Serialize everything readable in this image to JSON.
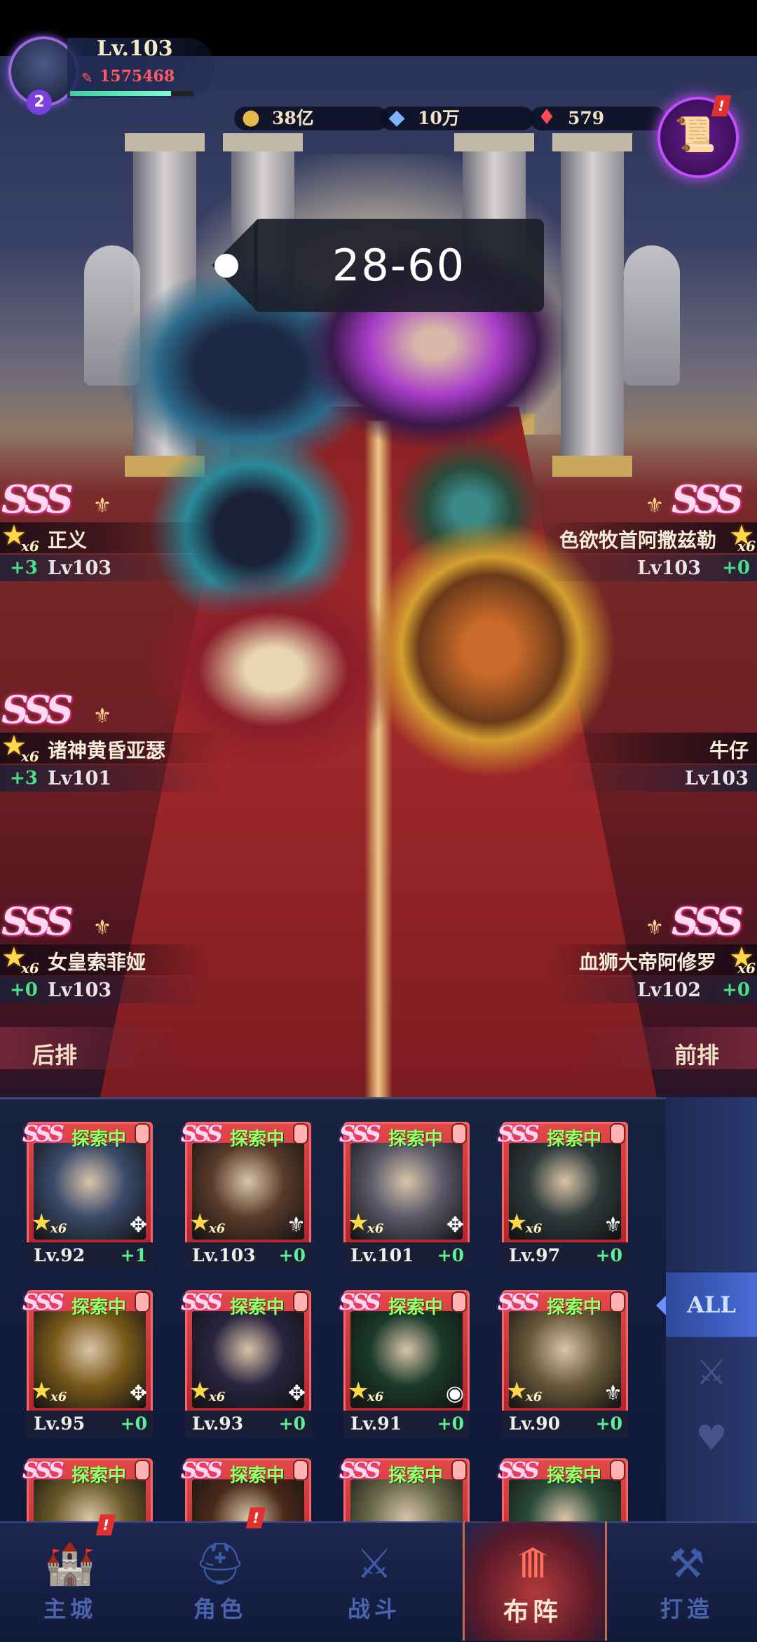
{
  "player": {
    "level": "Lv.103",
    "power": "1575468",
    "vip": "2"
  },
  "currencies": [
    {
      "icon": "gold-coin-icon",
      "value": "38亿"
    },
    {
      "icon": "diamond-icon",
      "value": "10万"
    },
    {
      "icon": "ruby-icon",
      "value": "579"
    }
  ],
  "stage": {
    "label": "28-60"
  },
  "formation": {
    "back_label": "后排",
    "front_label": "前排",
    "heroes": [
      {
        "name": "正义",
        "plus": "+3",
        "level": "Lv103",
        "grade": "SSS",
        "stars": "x6"
      },
      {
        "name": "色欲牧首阿撒兹勒",
        "plus": "+0",
        "level": "Lv103",
        "grade": "SSS",
        "stars": "x6"
      },
      {
        "name": "诸神黄昏亚瑟",
        "plus": "+3",
        "level": "Lv101",
        "grade": "SSS",
        "stars": "x6"
      },
      {
        "name": "牛仔",
        "plus": "",
        "level": "Lv103",
        "grade": "",
        "stars": ""
      },
      {
        "name": "女皇索菲娅",
        "plus": "+0",
        "level": "Lv103",
        "grade": "SSS",
        "stars": "x6"
      },
      {
        "name": "血狮大帝阿修罗",
        "plus": "+0",
        "level": "Lv102",
        "grade": "SSS",
        "stars": "x6"
      }
    ]
  },
  "roster": {
    "status": "探索中",
    "grade": "SSS",
    "stars": "x6",
    "cards": [
      {
        "level": "Lv.92",
        "plus": "+1",
        "color": "#3a4a6a",
        "emblem": "sword"
      },
      {
        "level": "Lv.103",
        "plus": "+0",
        "color": "#5a3b2a",
        "emblem": "shield"
      },
      {
        "level": "Lv.101",
        "plus": "+0",
        "color": "#5a5a6a",
        "emblem": "sword"
      },
      {
        "level": "Lv.97",
        "plus": "+0",
        "color": "#2e3a3a",
        "emblem": "shield"
      },
      {
        "level": "Lv.95",
        "plus": "+0",
        "color": "#7a5a1a",
        "emblem": "sword"
      },
      {
        "level": "Lv.93",
        "plus": "+0",
        "color": "#2a2440",
        "emblem": "sword"
      },
      {
        "level": "Lv.91",
        "plus": "+0",
        "color": "#1a3a2a",
        "emblem": "orb"
      },
      {
        "level": "Lv.90",
        "plus": "+0",
        "color": "#6a5a3a",
        "emblem": "shield"
      },
      {
        "level": "",
        "plus": "",
        "color": "#6a5a2a",
        "emblem": ""
      },
      {
        "level": "",
        "plus": "",
        "color": "#4a2a1a",
        "emblem": ""
      },
      {
        "level": "",
        "plus": "",
        "color": "#6a6a4a",
        "emblem": ""
      },
      {
        "level": "",
        "plus": "",
        "color": "#2a4a3a",
        "emblem": ""
      }
    ]
  },
  "filters": {
    "all": "ALL"
  },
  "nav": [
    {
      "label": "主城",
      "icon": "castle-icon"
    },
    {
      "label": "角色",
      "icon": "helmet-icon"
    },
    {
      "label": "战斗",
      "icon": "crossed-swords-icon"
    },
    {
      "label": "布阵",
      "icon": "formation-icon",
      "active": true
    },
    {
      "label": "打造",
      "icon": "anvil-icon"
    }
  ]
}
